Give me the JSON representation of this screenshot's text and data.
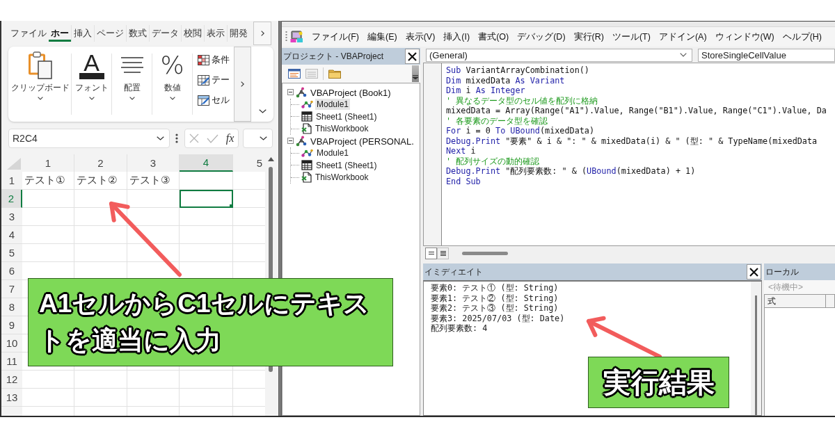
{
  "excel": {
    "ribbon_tabs": [
      {
        "label": "ファイル",
        "selected": false
      },
      {
        "label": "ホー",
        "selected": true
      },
      {
        "label": "挿入",
        "selected": false
      },
      {
        "label": "ページ",
        "selected": false
      },
      {
        "label": "数式",
        "selected": false
      },
      {
        "label": "データ",
        "selected": false
      },
      {
        "label": "校閲",
        "selected": false
      },
      {
        "label": "表示",
        "selected": false
      },
      {
        "label": "開発",
        "selected": false
      }
    ],
    "ribbon_groups": [
      {
        "kind": "clipboard",
        "label": "クリップボード"
      },
      {
        "kind": "font",
        "label": "フォント",
        "glyph": "A"
      },
      {
        "kind": "alignment",
        "label": "配置"
      },
      {
        "kind": "number",
        "label": "数値",
        "glyph": "%"
      }
    ],
    "style_commands": [
      {
        "kind": "conditional",
        "label": "条件"
      },
      {
        "kind": "table",
        "label": "テー"
      },
      {
        "kind": "cell_style",
        "label": "セル"
      }
    ],
    "formula_bar": {
      "name_box": "R2C4",
      "function_button": "fx"
    },
    "columns": [
      {
        "label": "1",
        "selected": false
      },
      {
        "label": "2",
        "selected": false
      },
      {
        "label": "3",
        "selected": false
      },
      {
        "label": "4",
        "selected": true
      },
      {
        "label": "5",
        "selected": false
      }
    ],
    "rows": [
      {
        "label": "1",
        "selected": false,
        "cells": [
          "テスト①",
          "テスト②",
          "テスト③"
        ]
      },
      {
        "label": "2",
        "selected": true
      },
      {
        "label": "3",
        "selected": false
      },
      {
        "label": "4",
        "selected": false
      },
      {
        "label": "5",
        "selected": false
      },
      {
        "label": "6",
        "selected": false
      },
      {
        "label": "7",
        "selected": false
      },
      {
        "label": "8",
        "selected": false
      },
      {
        "label": "9",
        "selected": false
      },
      {
        "label": "10",
        "selected": false
      },
      {
        "label": "11",
        "selected": false
      },
      {
        "label": "12",
        "selected": false
      },
      {
        "label": "13",
        "selected": false
      }
    ]
  },
  "vba": {
    "menu": [
      "ファイル(F)",
      "編集(E)",
      "表示(V)",
      "挿入(I)",
      "書式(O)",
      "デバッグ(D)",
      "実行(R)",
      "ツール(T)",
      "アドイン(A)",
      "ウィンドウ(W)",
      "ヘルプ(H)"
    ],
    "project": {
      "title": "プロジェクト - VBAProject",
      "tree": [
        {
          "kind": "project",
          "label": "VBAProject (Book1)",
          "selected": false,
          "expanded": true,
          "children": [
            {
              "kind": "module",
              "label": "Module1",
              "selected": true
            },
            {
              "kind": "sheet",
              "label": "Sheet1 (Sheet1)",
              "selected": false
            },
            {
              "kind": "workbook",
              "label": "ThisWorkbook",
              "selected": false
            }
          ]
        },
        {
          "kind": "project",
          "label": "VBAProject (PERSONAL.",
          "selected": false,
          "expanded": true,
          "children": [
            {
              "kind": "module",
              "label": "Module1",
              "selected": false
            },
            {
              "kind": "sheet",
              "label": "Sheet1 (Sheet1)",
              "selected": false
            },
            {
              "kind": "workbook",
              "label": "ThisWorkbook",
              "selected": false
            }
          ]
        }
      ]
    },
    "code": {
      "object": "(General)",
      "procedure": "StoreSingleCellValue",
      "lines": [
        {
          "tokens": [
            {
              "kind": "keyword",
              "text": "Sub"
            },
            {
              "kind": "text",
              "text": " VariantArrayCombination()"
            }
          ]
        },
        {
          "tokens": [
            {
              "kind": "keyword",
              "text": "Dim"
            },
            {
              "kind": "text",
              "text": " mixedData "
            },
            {
              "kind": "keyword",
              "text": "As Variant"
            }
          ]
        },
        {
          "tokens": [
            {
              "kind": "keyword",
              "text": "Dim"
            },
            {
              "kind": "text",
              "text": " i "
            },
            {
              "kind": "keyword",
              "text": "As Integer"
            }
          ]
        },
        {
          "tokens": [
            {
              "kind": "comment",
              "text": "' 異なるデータ型のセル値を配列に格納"
            }
          ]
        },
        {
          "tokens": [
            {
              "kind": "text",
              "text": "mixedData = Array(Range(\"A1\").Value, Range(\"B1\").Value, Range(\"C1\").Value, Da"
            }
          ]
        },
        {
          "tokens": [
            {
              "kind": "comment",
              "text": "' 各要素のデータ型を確認"
            }
          ]
        },
        {
          "tokens": [
            {
              "kind": "keyword",
              "text": "For"
            },
            {
              "kind": "text",
              "text": " i = 0 "
            },
            {
              "kind": "keyword",
              "text": "To UBound"
            },
            {
              "kind": "text",
              "text": "(mixedData)"
            }
          ]
        },
        {
          "tokens": [
            {
              "kind": "keyword",
              "text": "Debug.Print"
            },
            {
              "kind": "text",
              "text": " \"要素\" & i & \": \" & mixedData(i) & \" (型: \" & TypeName(mixedData"
            }
          ]
        },
        {
          "tokens": [
            {
              "kind": "keyword",
              "text": "Next"
            },
            {
              "kind": "text",
              "text": " i"
            }
          ]
        },
        {
          "tokens": [
            {
              "kind": "comment",
              "text": "' 配列サイズの動的確認"
            }
          ]
        },
        {
          "tokens": [
            {
              "kind": "keyword",
              "text": "Debug.Print"
            },
            {
              "kind": "text",
              "text": " \"配列要素数: \" & ("
            },
            {
              "kind": "keyword",
              "text": "UBound"
            },
            {
              "kind": "text",
              "text": "(mixedData) + 1)"
            }
          ]
        },
        {
          "tokens": [
            {
              "kind": "keyword",
              "text": "End Sub"
            }
          ]
        }
      ]
    },
    "immediate": {
      "title": "イミディエイト",
      "lines": [
        "要素0: テスト① (型: String)",
        "要素1: テスト② (型: String)",
        "要素2: テスト③ (型: String)",
        "要素3: 2025/07/03 (型: Date)",
        "配列要素数: 4"
      ]
    },
    "locals": {
      "title": "ローカル",
      "status": "<待機中>",
      "columns": [
        "式"
      ]
    }
  },
  "callouts": [
    {
      "text": "A1セルからC1セルにテキストを適当に入力"
    },
    {
      "text": "実行結果"
    }
  ]
}
